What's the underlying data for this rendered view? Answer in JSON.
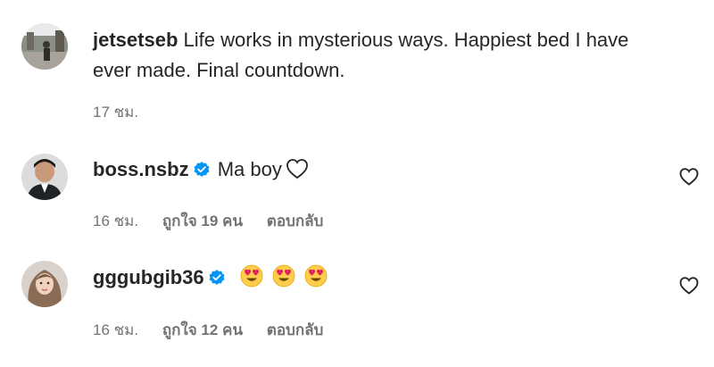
{
  "caption": {
    "username": "jetsetseb",
    "text": "Life works in mysterious ways. Happiest bed I have ever made. Final countdown.",
    "time": "17 ชม."
  },
  "comments": [
    {
      "username": "boss.nsbz",
      "verified": true,
      "text": "Ma boy",
      "time": "16 ชม.",
      "likes": "ถูกใจ 19 คน",
      "reply": "ตอบกลับ"
    },
    {
      "username": "gggubgib36",
      "verified": true,
      "emojis": [
        "heart-eyes-emoji",
        "heart-eyes-emoji",
        "heart-eyes-emoji"
      ],
      "time": "16 ชม.",
      "likes": "ถูกใจ 12 คน",
      "reply": "ตอบกลับ"
    }
  ],
  "colors": {
    "text": "#262626",
    "secondary": "#737373",
    "verified": "#0095f6"
  }
}
